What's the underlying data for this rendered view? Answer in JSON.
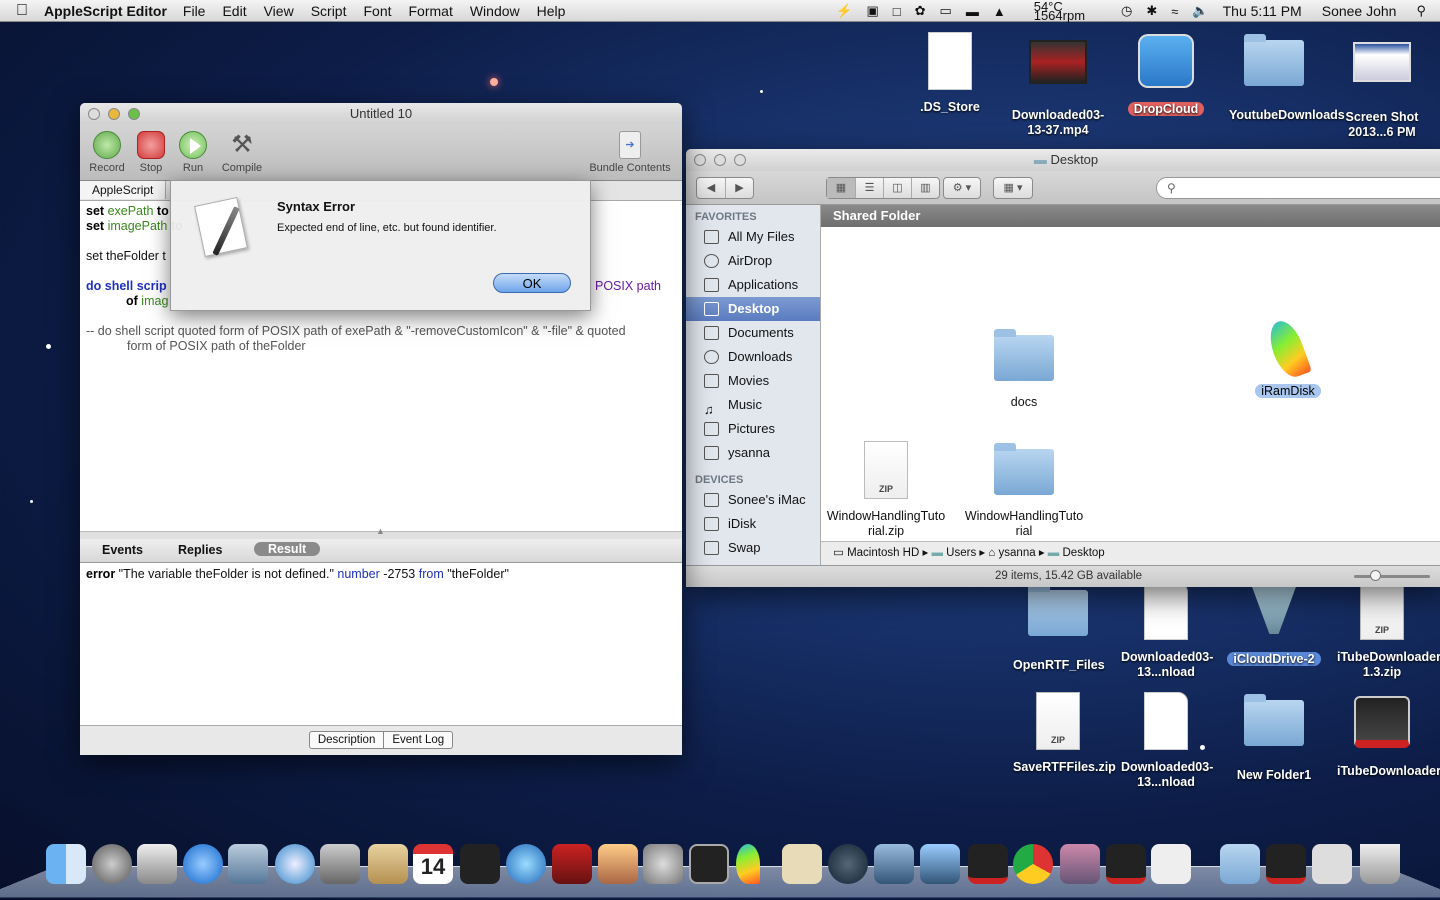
{
  "menubar": {
    "app": "AppleScript Editor",
    "menus": [
      "File",
      "Edit",
      "View",
      "Script",
      "Font",
      "Format",
      "Window",
      "Help"
    ],
    "temp": "54°C",
    "rpm": "1564rpm",
    "clock": "Thu 5:11 PM",
    "user": "Sonee John"
  },
  "desktop": {
    "icons": [
      {
        "label": ".DS_Store"
      },
      {
        "label": "Downloaded03-13-37.mp4"
      },
      {
        "label": "DropCloud"
      },
      {
        "label": "YoutubeDownloads"
      },
      {
        "label": "Screen Shot 2013...6 PM"
      },
      {
        "label": "OpenRTF_Files"
      },
      {
        "label": "Downloaded03-13...nload"
      },
      {
        "label": "iCloudDrive-2"
      },
      {
        "label": "iTubeDownloader 1.3.zip"
      },
      {
        "label": "SaveRTFFiles.zip"
      },
      {
        "label": "Downloaded03-13...nload"
      },
      {
        "label": "New Folder1"
      },
      {
        "label": "iTubeDownloader"
      }
    ]
  },
  "script_editor": {
    "title": "Untitled 10",
    "toolbar": {
      "record": "Record",
      "stop": "Stop",
      "run": "Run",
      "compile": "Compile",
      "bundle": "Bundle Contents"
    },
    "language": "AppleScript",
    "code": {
      "l1_kw": "set",
      "l1_var": "exePath",
      "l1_rest": "to",
      "l2_kw": "set",
      "l2_var": "imagePath",
      "l2_rest": "to",
      "l3": "set theFolder t",
      "l4_kw": "do shell scrip",
      "l4_end": "POSIX path",
      "l5_kw": "of",
      "l5_var": "imag",
      "l6": "-- do shell script quoted form of POSIX path of exePath & \"-removeCustomIcon\" & \"-file\" & quoted",
      "l7": "form of POSIX path of theFolder"
    },
    "result_tabs": {
      "events": "Events",
      "replies": "Replies",
      "result": "Result"
    },
    "result": {
      "kw1": "error",
      "str1": "\"The variable theFolder is not defined.\"",
      "kw2": "number",
      "num": "-2753",
      "kw3": "from",
      "str2": "\"theFolder\""
    },
    "bottom": {
      "description": "Description",
      "event_log": "Event Log"
    }
  },
  "dialog": {
    "title": "Syntax Error",
    "message": "Expected end of line, etc. but found identifier.",
    "ok": "OK"
  },
  "finder": {
    "title": "Desktop",
    "sidebar": {
      "favorites_header": "FAVORITES",
      "favorites": [
        "All My Files",
        "AirDrop",
        "Applications",
        "Desktop",
        "Documents",
        "Downloads",
        "Movies",
        "Music",
        "Pictures",
        "ysanna"
      ],
      "devices_header": "DEVICES",
      "devices": [
        "Sonee's iMac",
        "iDisk",
        "Swap"
      ]
    },
    "header": "Shared Folder",
    "items": [
      {
        "label": "docs"
      },
      {
        "label": "iRamDisk"
      },
      {
        "label": "WindowHandlingTutorial.zip"
      },
      {
        "label": "WindowHandlingTutorial"
      }
    ],
    "path": [
      "Macintosh HD",
      "Users",
      "ysanna",
      "Desktop"
    ],
    "status": "29 items, 15.42 GB available"
  }
}
